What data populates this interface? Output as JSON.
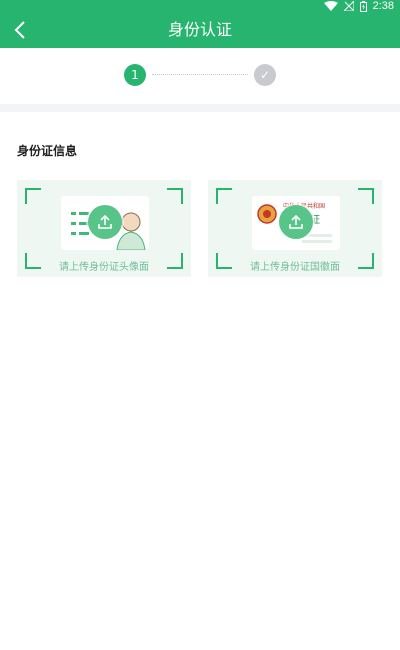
{
  "status_bar": {
    "time": "2:38",
    "icons": [
      "wifi-icon",
      "signal-icon",
      "battery-icon"
    ]
  },
  "header": {
    "title": "身份认证",
    "back_icon": "chevron-left-icon"
  },
  "stepper": {
    "steps": [
      {
        "label": "1",
        "state": "active"
      },
      {
        "label": "✓",
        "state": "pending"
      }
    ]
  },
  "section": {
    "title": "身份证信息"
  },
  "cards": [
    {
      "label": "请上传身份证头像面",
      "icon": "upload-icon"
    },
    {
      "label": "请上传身份证国徽面",
      "icon": "upload-icon"
    }
  ],
  "id_back_text": {
    "line1": "中华人民共和国",
    "line2": "身份证"
  },
  "colors": {
    "brand_green": "#27b46e",
    "card_bg": "#eef7f2",
    "step_pending": "#c8cad0",
    "label_green": "#6fbf98"
  }
}
